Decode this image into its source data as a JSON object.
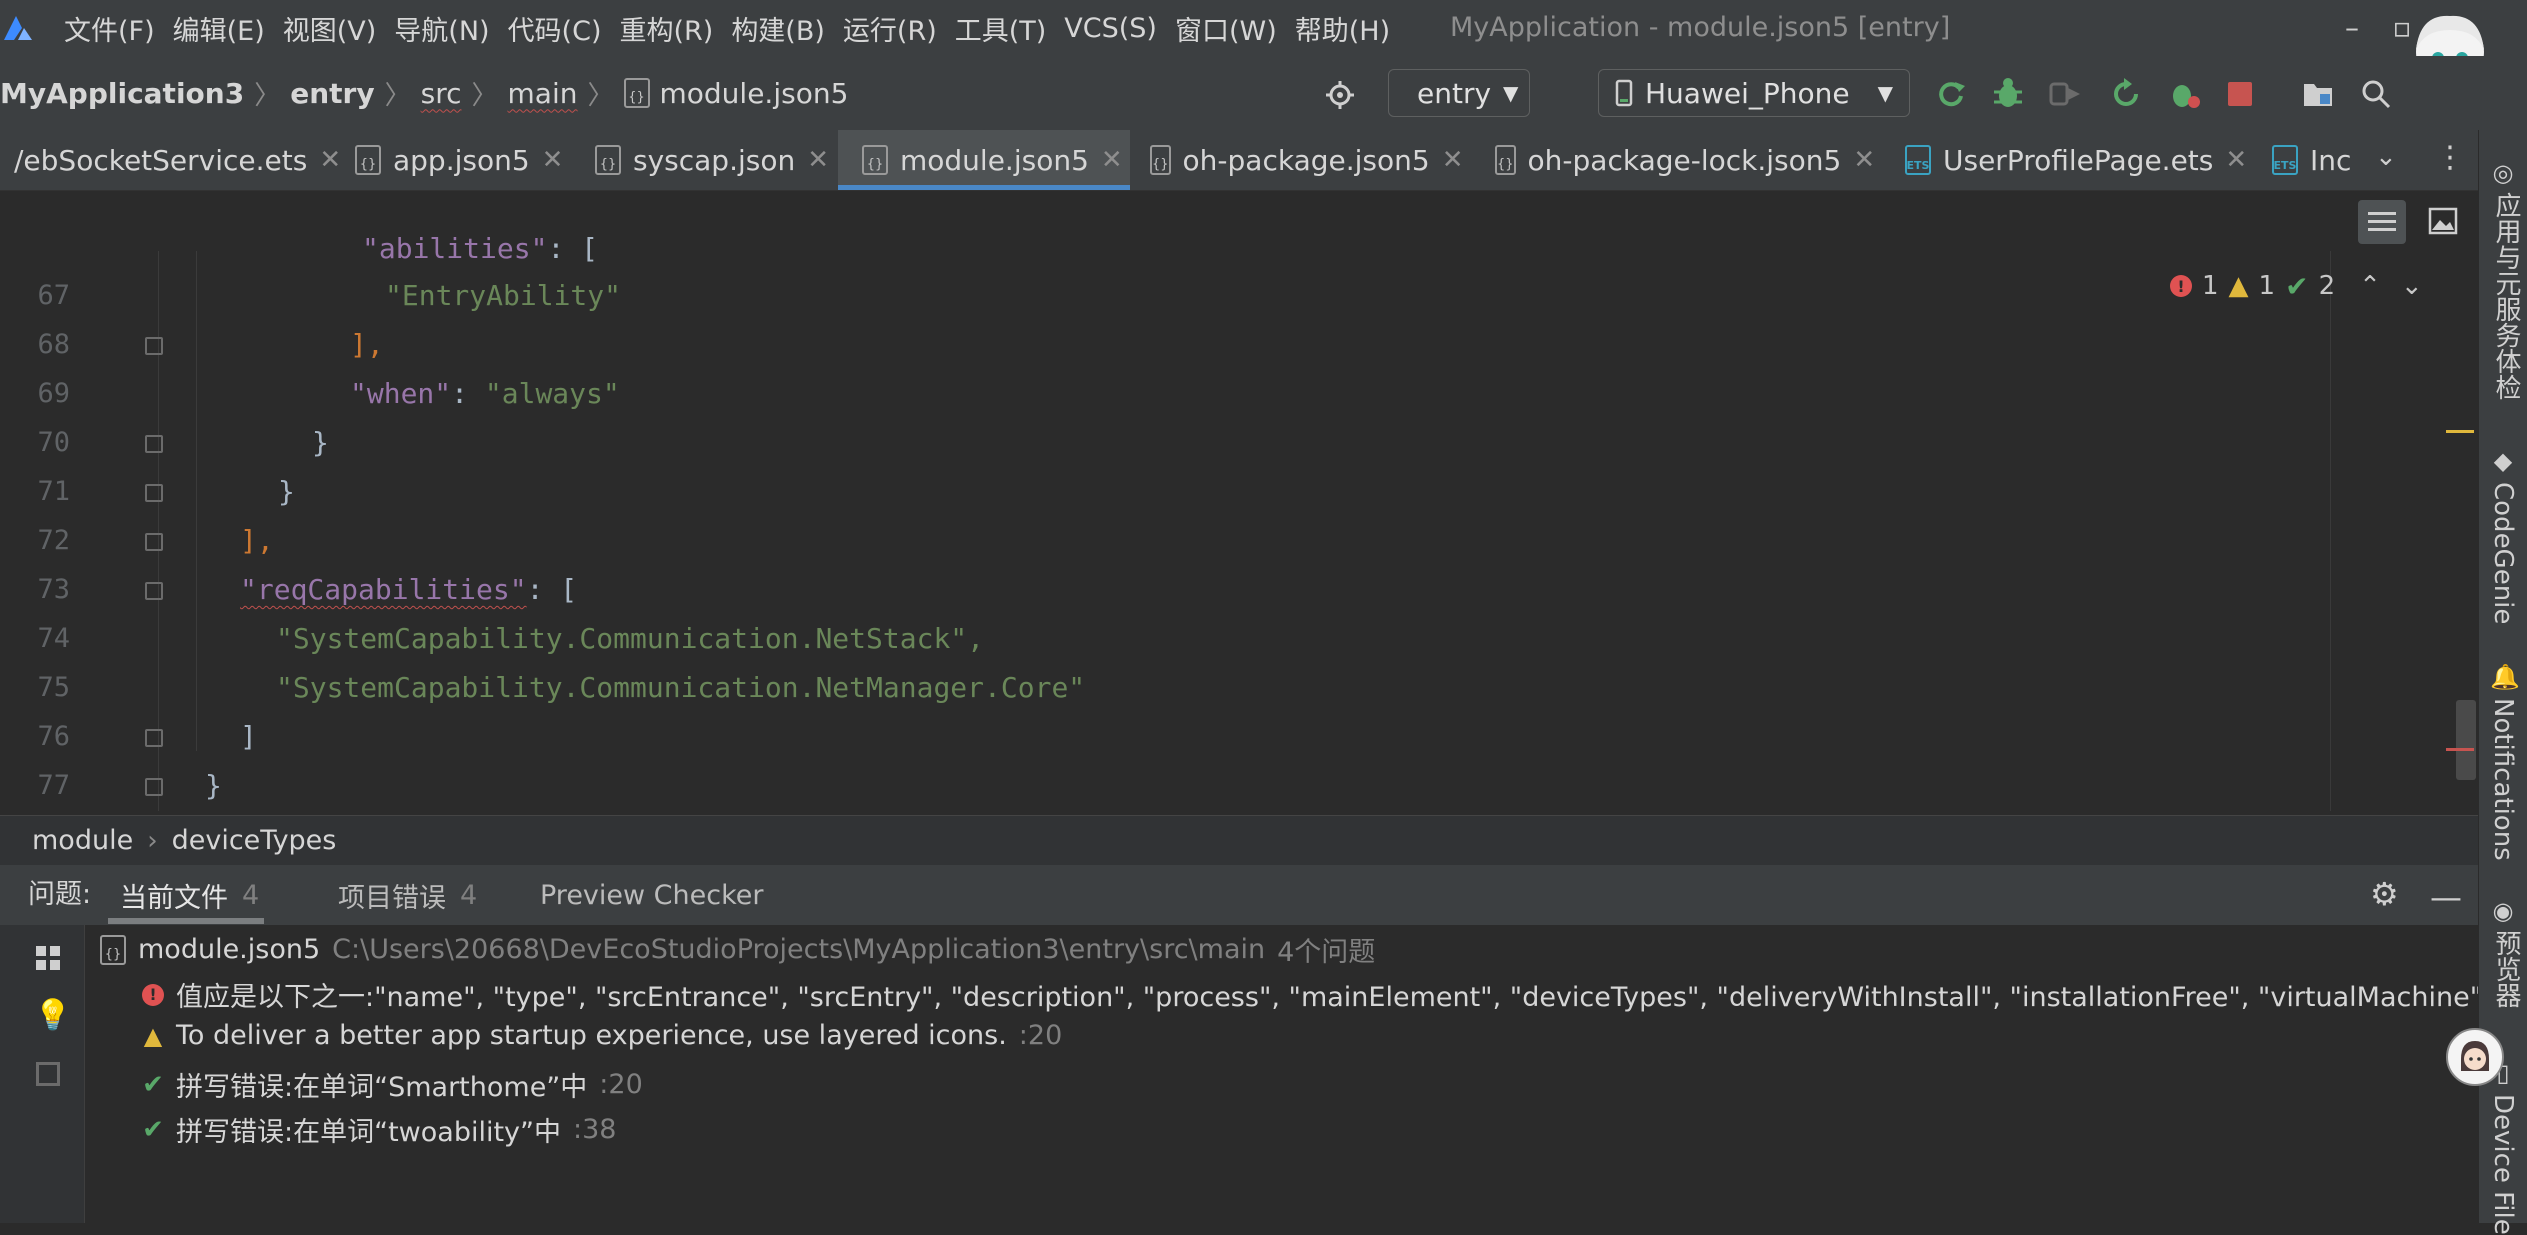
{
  "menu": {
    "items": [
      "文件(F)",
      "编辑(E)",
      "视图(V)",
      "导航(N)",
      "代码(C)",
      "重构(R)",
      "构建(B)",
      "运行(R)",
      "工具(T)",
      "VCS(S)",
      "窗口(W)",
      "帮助(H)"
    ],
    "window_title": "MyApplication - module.json5 [entry]"
  },
  "breadcrumb": {
    "project": "MyApplication3",
    "module": "entry",
    "src": "src",
    "main": "main",
    "file": "module.json5"
  },
  "toolbar": {
    "run_config": "entry",
    "device": "Huawei_Phone"
  },
  "tabs": [
    {
      "label": "/ebSocketService.ets",
      "type": "ets"
    },
    {
      "label": "app.json5",
      "type": "json"
    },
    {
      "label": "syscap.json",
      "type": "json"
    },
    {
      "label": "module.json5",
      "type": "json",
      "active": true
    },
    {
      "label": "oh-package.json5",
      "type": "json"
    },
    {
      "label": "oh-package-lock.json5",
      "type": "json"
    },
    {
      "label": "UserProfilePage.ets",
      "type": "ets"
    },
    {
      "label": "Inc",
      "type": "ets"
    }
  ],
  "editor": {
    "lines": [
      {
        "n": "67",
        "code": "\"EntryAbility\""
      },
      {
        "n": "68",
        "code": "],"
      },
      {
        "n": "69",
        "code": "\"when\": \"always\""
      },
      {
        "n": "70",
        "code": "}"
      },
      {
        "n": "71",
        "code": "}"
      },
      {
        "n": "72",
        "code": "],"
      },
      {
        "n": "73",
        "code": "\"reqCapabilities\": ["
      },
      {
        "n": "74",
        "code": "\"SystemCapability.Communication.NetStack\","
      },
      {
        "n": "75",
        "code": "\"SystemCapability.Communication.NetManager.Core\""
      },
      {
        "n": "76",
        "code": "]"
      },
      {
        "n": "77",
        "code": "}"
      }
    ],
    "inspection": {
      "errors": "1",
      "warnings": "1",
      "typos": "2"
    }
  },
  "editor_breadcrumb": [
    "module",
    "deviceTypes"
  ],
  "problems": {
    "label": "问题:",
    "tabs": [
      {
        "label": "当前文件",
        "count": "4"
      },
      {
        "label": "项目错误",
        "count": "4"
      },
      {
        "label": "Preview Checker",
        "count": ""
      }
    ],
    "file": {
      "name": "module.json5",
      "path": "C:\\Users\\20668\\DevEcoStudioProjects\\MyApplication3\\entry\\src\\main",
      "summary": "4个问题"
    },
    "items": [
      {
        "severity": "error",
        "text": "值应是以下之一:\"name\", \"type\", \"srcEntrance\", \"srcEntry\", \"description\", \"process\", \"mainElement\", \"deviceTypes\", \"deliveryWithInstall\", \"installationFree\", \"virtualMachine\", \"uiSynta",
        "loc": ""
      },
      {
        "severity": "warning",
        "text": "To deliver a better app startup experience, use layered icons.",
        "loc": ":20"
      },
      {
        "severity": "typo",
        "text": "拼写错误:在单词“Smarthome”中",
        "loc": ":20"
      },
      {
        "severity": "typo",
        "text": "拼写错误:在单词“twoability”中",
        "loc": ":38"
      }
    ]
  },
  "right_sidebar": [
    "应用与元服务体检",
    "CodeGenie",
    "Notifications",
    "预览器",
    "Device File"
  ],
  "colors": {
    "accent": "#4a88c7",
    "error": "#e05252",
    "warning": "#e0b83c",
    "typo": "#59a869",
    "stop": "#c75450"
  }
}
